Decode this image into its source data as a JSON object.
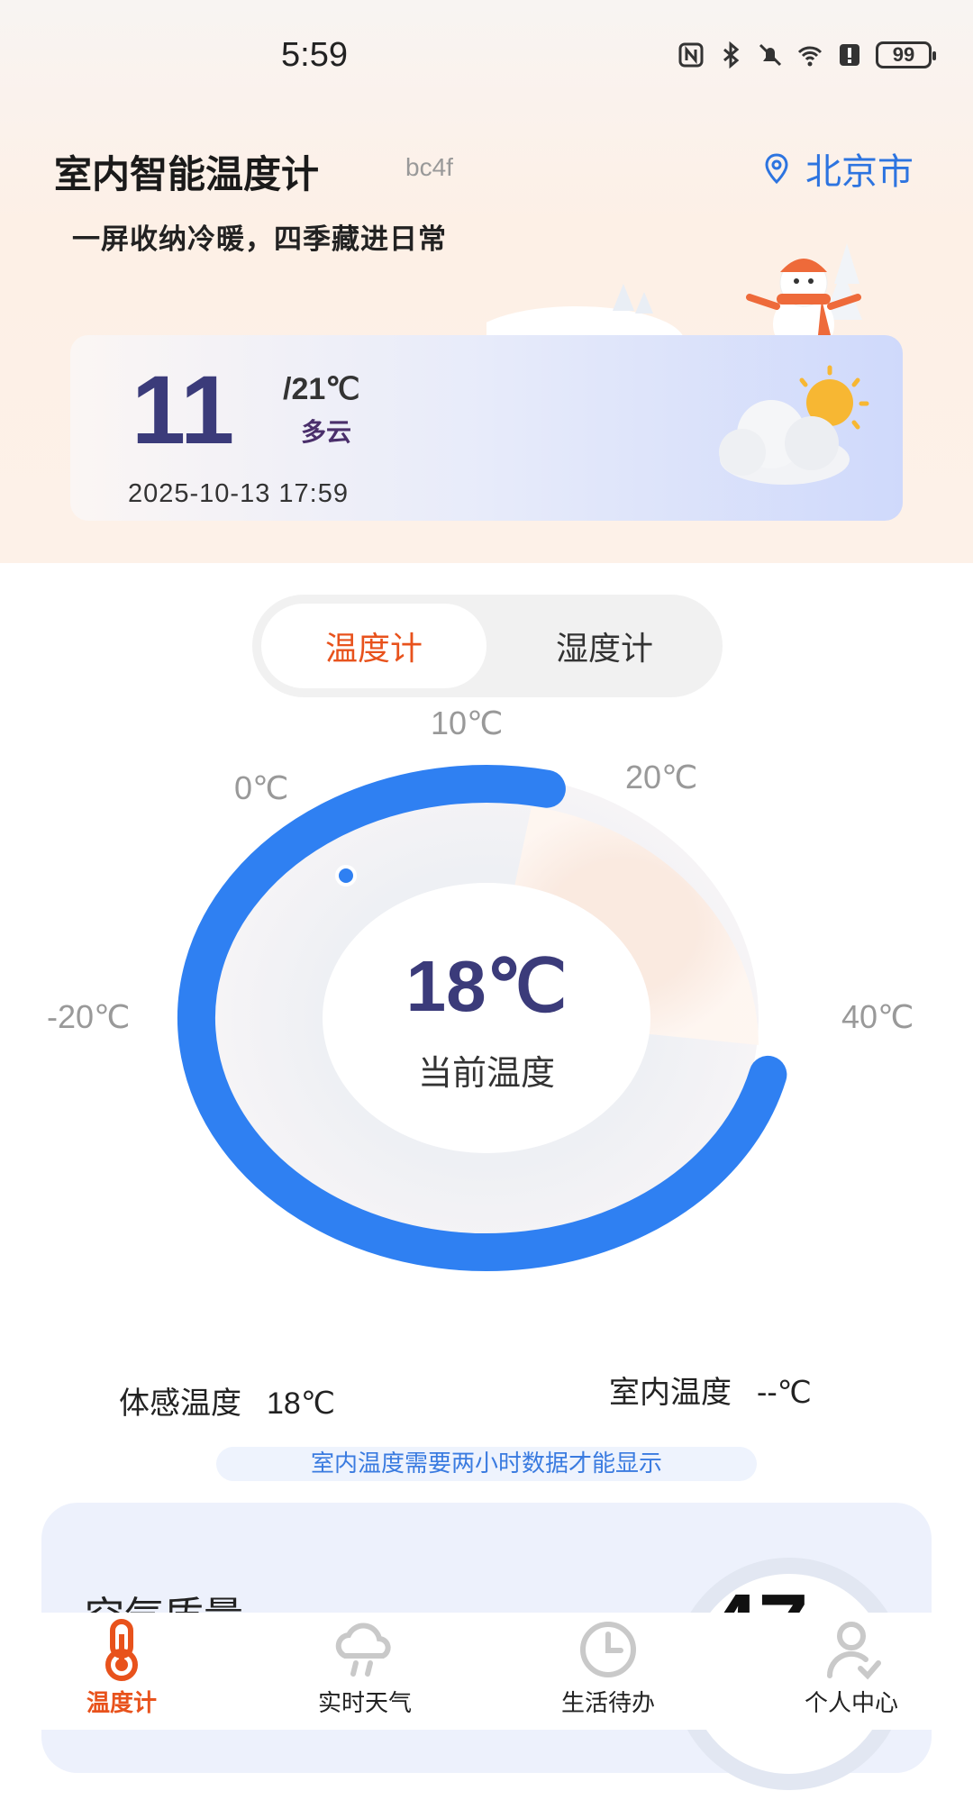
{
  "status_bar": {
    "time": "5:59",
    "battery": "99"
  },
  "header": {
    "title": "室内智能温度计",
    "code": "bc4f",
    "location": "北京市",
    "slogan": "一屏收纳冷暖，四季藏进日常"
  },
  "weather": {
    "current": "11",
    "high": "/21℃",
    "condition": "多云",
    "datetime": "2025-10-13 17:59",
    "icon": "partly-cloudy-icon"
  },
  "toggle": {
    "active": "温度计",
    "inactive": "湿度计"
  },
  "gauge": {
    "scale": [
      "-20℃",
      "0℃",
      "10℃",
      "20℃",
      "40℃"
    ],
    "current_temp": "18℃",
    "current_label": "当前温度",
    "range_min": -20,
    "range_max": 40,
    "value": 18
  },
  "readings": {
    "feel_label": "体感温度",
    "feel_value": "18℃",
    "indoor_label": "室内温度",
    "indoor_value": "--℃",
    "notice": "室内温度需要两小时数据才能显示"
  },
  "air": {
    "title": "空气质量",
    "value": "47"
  },
  "nav": [
    {
      "label": "温度计",
      "icon": "thermometer-icon",
      "active": true
    },
    {
      "label": "实时天气",
      "icon": "cloud-rain-icon",
      "active": false
    },
    {
      "label": "生活待办",
      "icon": "clock-icon",
      "active": false
    },
    {
      "label": "个人中心",
      "icon": "user-icon",
      "active": false
    }
  ],
  "colors": {
    "accent": "#2f80f2",
    "active_tab": "#e8521c",
    "temp_text": "#3b3b7a"
  }
}
